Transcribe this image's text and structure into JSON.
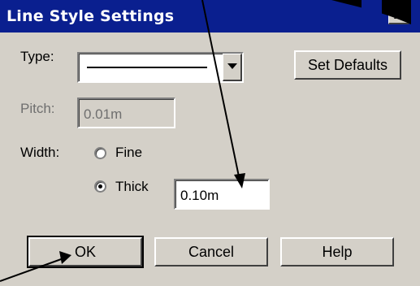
{
  "window": {
    "title": "Line Style Settings",
    "close_label": "x"
  },
  "type_field": {
    "label": "Type:",
    "value": "solid-line"
  },
  "set_defaults_label": "Set Defaults",
  "pitch_field": {
    "label": "Pitch:",
    "value": "0.01m",
    "disabled": true
  },
  "width_field": {
    "label": "Width:",
    "options": [
      {
        "label": "Fine",
        "selected": false
      },
      {
        "label": "Thick",
        "selected": true
      }
    ],
    "thick_value": "0.10m"
  },
  "buttons": {
    "ok": "OK",
    "cancel": "Cancel",
    "help": "Help"
  },
  "colors": {
    "titlebar": "#0a1f8f",
    "dialog": "#d4d0c8",
    "annotation": "#000000"
  }
}
